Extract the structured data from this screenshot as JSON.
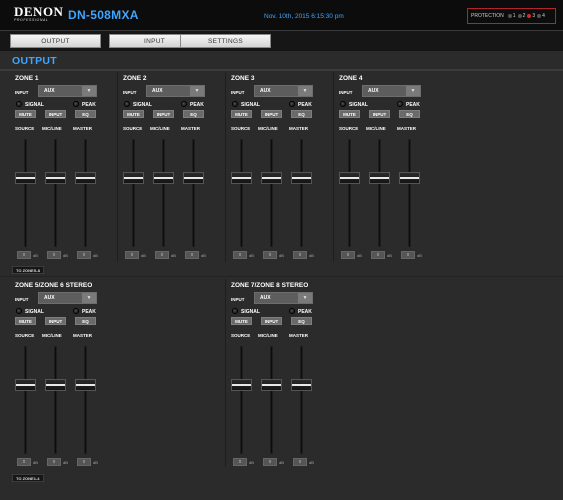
{
  "header": {
    "brand": "DENON",
    "brand_sub": "PROFESSIONAL",
    "model": "DN-508MXA",
    "datetime": "Nov. 10th, 2015 6:15:30 pm",
    "protection": {
      "label": "PROTECTION",
      "leds": [
        {
          "num": "1",
          "color": "#555555"
        },
        {
          "num": "2",
          "color": "#555555"
        },
        {
          "num": "3",
          "color": "#d42a2a"
        },
        {
          "num": "4",
          "color": "#555555"
        }
      ]
    }
  },
  "nav": {
    "tabs": [
      {
        "label": "OUTPUT"
      },
      {
        "label": "INPUT"
      },
      {
        "label": "SETTINGS"
      }
    ]
  },
  "page_title": "OUTPUT",
  "labels": {
    "input": "INPUT",
    "signal": "SIGNAL",
    "peak": "PEAK",
    "mute": "MUTE",
    "input_btn": "INPUT",
    "eq": "EQ",
    "source": "SOURCE",
    "micline": "MIC/LINE",
    "master": "MASTER",
    "db": "dB",
    "arrow": "▼"
  },
  "zones": [
    {
      "name": "ZONE 1",
      "input": "AUX",
      "source_db": "0",
      "micline_db": "0",
      "master_db": "0"
    },
    {
      "name": "ZONE 2",
      "input": "AUX",
      "source_db": "0",
      "micline_db": "0",
      "master_db": "0"
    },
    {
      "name": "ZONE 3",
      "input": "AUX",
      "source_db": "0",
      "micline_db": "0",
      "master_db": "0"
    },
    {
      "name": "ZONE 4",
      "input": "AUX",
      "source_db": "0",
      "micline_db": "0",
      "master_db": "0"
    },
    {
      "name": "ZONE 5/ZONE 6 STEREO",
      "input": "AUX",
      "source_db": "0",
      "micline_db": "0",
      "master_db": "0"
    },
    {
      "name": "ZONE 7/ZONE 8 STEREO",
      "input": "AUX",
      "source_db": "0",
      "micline_db": "0",
      "master_db": "0"
    }
  ],
  "links": {
    "to_zones": "TO ZONES-8",
    "to_zone": "TO ZONE1-4"
  }
}
